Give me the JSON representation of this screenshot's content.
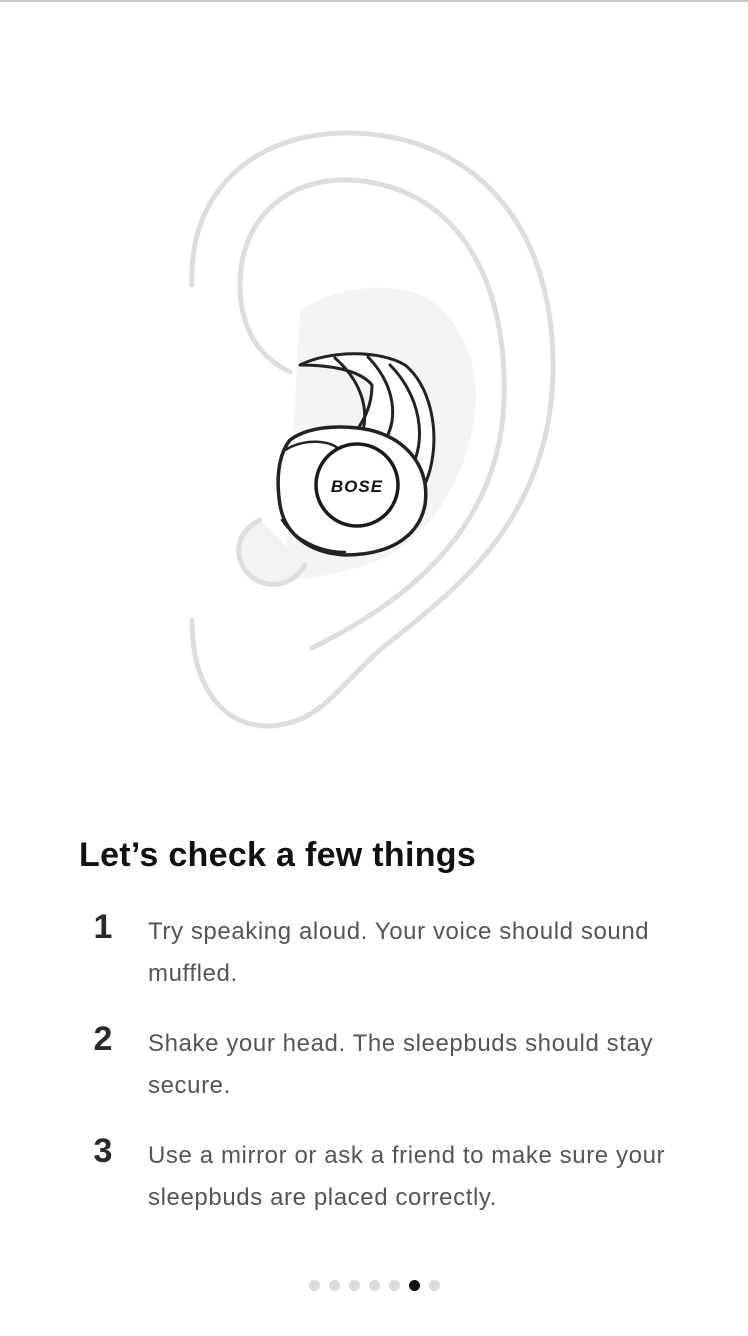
{
  "title": "Let’s check a few things",
  "illustration": {
    "logo_text": "BOSE"
  },
  "steps": [
    {
      "number": "1",
      "text": "Try speaking aloud. Your voice should sound muffled."
    },
    {
      "number": "2",
      "text": "Shake your head. The sleepbuds should stay secure."
    },
    {
      "number": "3",
      "text": "Use a mirror or ask a friend to make sure your sleepbuds are placed correctly."
    }
  ],
  "pager": {
    "total": 7,
    "active_index": 5
  },
  "colors": {
    "dot_active": "#111111",
    "dot_inactive": "#d9d9d9",
    "ear_outline": "#dddddd"
  }
}
